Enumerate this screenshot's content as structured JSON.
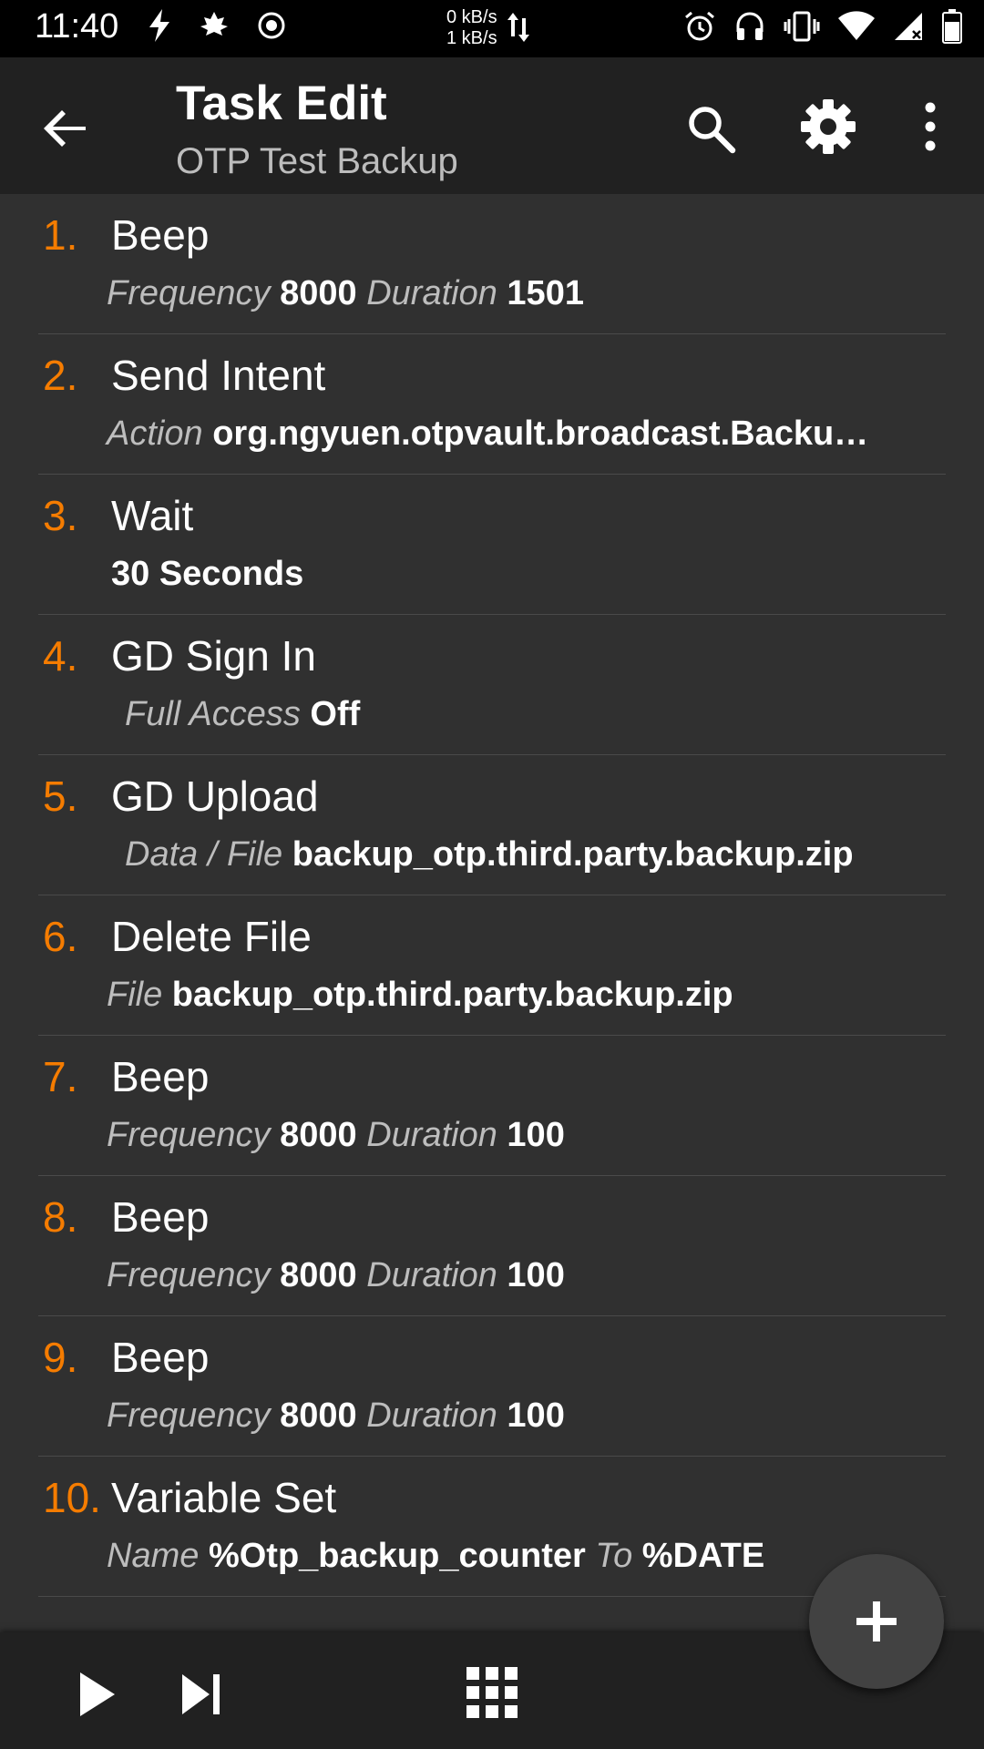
{
  "status_bar": {
    "time": "11:40",
    "net_down": "0 kB/s",
    "net_up": "1 kB/s",
    "left_icons": [
      "flash-icon",
      "leaf-icon",
      "record-icon"
    ],
    "right_icons": [
      "alarm-icon",
      "headset-icon",
      "vibrate-icon",
      "wifi-icon",
      "signal-icon",
      "battery-icon"
    ]
  },
  "app_bar": {
    "title": "Task Edit",
    "subtitle": "OTP Test Backup",
    "actions": [
      "search-icon",
      "gear-icon",
      "more-vert-icon"
    ]
  },
  "actions": [
    {
      "num": "1.",
      "title": "Beep",
      "details": [
        {
          "label": "Frequency",
          "value": "8000"
        },
        {
          "label": "Duration",
          "value": "1501"
        }
      ]
    },
    {
      "num": "2.",
      "title": "Send Intent",
      "details": [
        {
          "label": "Action",
          "value": "org.ngyuen.otpvault.broadcast.Backu…"
        }
      ]
    },
    {
      "num": "3.",
      "title": "Wait",
      "details": [
        {
          "label": "",
          "value": "30 Seconds"
        }
      ]
    },
    {
      "num": "4.",
      "title": "GD Sign In",
      "details": [
        {
          "label": "Full Access",
          "value": "Off"
        }
      ]
    },
    {
      "num": "5.",
      "title": "GD Upload",
      "details": [
        {
          "label": "Data / File",
          "value": "backup_otp.third.party.backup.zip"
        }
      ]
    },
    {
      "num": "6.",
      "title": "Delete File",
      "details": [
        {
          "label": "File",
          "value": "backup_otp.third.party.backup.zip"
        }
      ]
    },
    {
      "num": "7.",
      "title": "Beep",
      "details": [
        {
          "label": "Frequency",
          "value": "8000"
        },
        {
          "label": "Duration",
          "value": "100"
        }
      ]
    },
    {
      "num": "8.",
      "title": "Beep",
      "details": [
        {
          "label": "Frequency",
          "value": "8000"
        },
        {
          "label": "Duration",
          "value": "100"
        }
      ]
    },
    {
      "num": "9.",
      "title": "Beep",
      "details": [
        {
          "label": "Frequency",
          "value": "8000"
        },
        {
          "label": "Duration",
          "value": "100"
        }
      ]
    },
    {
      "num": "10.",
      "title": "Variable Set",
      "details": [
        {
          "label": "Name",
          "value": "%Otp_backup_counter"
        },
        {
          "label": "To",
          "value": "%DATE"
        }
      ]
    }
  ],
  "fab": {
    "icon": "plus-icon"
  },
  "bottom_bar": {
    "icons": [
      "play-icon",
      "skip-next-icon",
      "apps-grid-icon"
    ]
  },
  "colors": {
    "accent": "#f57c00",
    "background": "#303030",
    "toolbar": "#212121"
  }
}
